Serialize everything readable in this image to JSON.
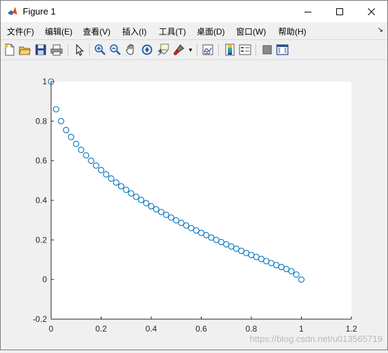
{
  "window": {
    "title": "Figure 1",
    "controls": {
      "minimize_icon": "minimize-icon",
      "maximize_icon": "maximize-icon",
      "close_icon": "close-icon"
    }
  },
  "menubar": {
    "items": [
      "文件(F)",
      "编辑(E)",
      "查看(V)",
      "插入(I)",
      "工具(T)",
      "桌面(D)",
      "窗口(W)",
      "帮助(H)"
    ],
    "overflow_icon": "dock-arrow-icon"
  },
  "toolbar": {
    "icons": [
      "new-figure-icon",
      "open-file-icon",
      "save-icon",
      "print-icon",
      "pointer-icon",
      "zoom-in-icon",
      "zoom-out-icon",
      "pan-hand-icon",
      "rotate-3d-icon",
      "data-cursor-icon",
      "brush-icon",
      "link-plot-icon",
      "colorbar-icon",
      "legend-icon",
      "hide-plot-tools-icon",
      "show-plot-tools-icon"
    ]
  },
  "watermark": "https://blog.csdn.net/u013565719",
  "colors": {
    "marker": "#0072BD",
    "axes_bg": "#ffffff",
    "figure_bg": "#f0f0f0"
  },
  "chart_data": {
    "type": "scatter",
    "marker": "open-circle",
    "title": "",
    "xlabel": "",
    "ylabel": "",
    "xlim": [
      0,
      1.2
    ],
    "ylim": [
      -0.2,
      1
    ],
    "xticks": [
      "0",
      "0.2",
      "0.4",
      "0.6",
      "0.8",
      "1",
      "1.2"
    ],
    "yticks": [
      "-0.2",
      "0",
      "0.2",
      "0.4",
      "0.6",
      "0.8",
      "1"
    ],
    "grid": false,
    "series": [
      {
        "x": [
          0,
          0.02,
          0.04,
          0.06,
          0.08,
          0.1,
          0.12,
          0.14,
          0.16,
          0.18,
          0.2,
          0.22,
          0.24,
          0.26,
          0.28,
          0.3,
          0.32,
          0.34,
          0.36,
          0.38,
          0.4,
          0.42,
          0.44,
          0.46,
          0.48,
          0.5,
          0.52,
          0.54,
          0.56,
          0.58,
          0.6,
          0.62,
          0.64,
          0.66,
          0.68,
          0.7,
          0.72,
          0.74,
          0.76,
          0.78,
          0.8,
          0.82,
          0.84,
          0.86,
          0.88,
          0.9,
          0.92,
          0.94,
          0.96,
          0.98,
          1
        ],
        "y": [
          1,
          0.86,
          0.8,
          0.755,
          0.72,
          0.685,
          0.655,
          0.627,
          0.6,
          0.576,
          0.553,
          0.531,
          0.51,
          0.49,
          0.471,
          0.453,
          0.435,
          0.418,
          0.402,
          0.386,
          0.37,
          0.355,
          0.341,
          0.327,
          0.313,
          0.299,
          0.286,
          0.273,
          0.26,
          0.248,
          0.236,
          0.224,
          0.212,
          0.2,
          0.189,
          0.178,
          0.167,
          0.156,
          0.145,
          0.134,
          0.124,
          0.114,
          0.104,
          0.093,
          0.083,
          0.073,
          0.063,
          0.053,
          0.042,
          0.025,
          0
        ]
      }
    ]
  }
}
